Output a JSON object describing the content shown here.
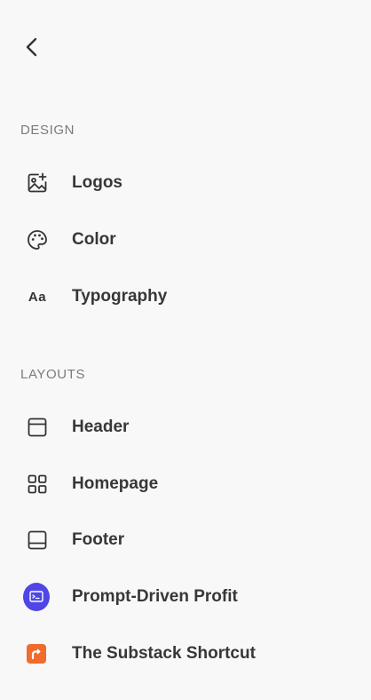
{
  "sections": {
    "design": {
      "title": "DESIGN",
      "items": [
        {
          "label": "Logos",
          "icon": "image-plus-icon"
        },
        {
          "label": "Color",
          "icon": "palette-icon"
        },
        {
          "label": "Typography",
          "icon": "typography-icon"
        }
      ]
    },
    "layouts": {
      "title": "LAYOUTS",
      "items": [
        {
          "label": "Header",
          "icon": "layout-header-icon"
        },
        {
          "label": "Homepage",
          "icon": "grid-icon"
        },
        {
          "label": "Footer",
          "icon": "layout-footer-icon"
        },
        {
          "label": "Prompt-Driven Profit",
          "icon": "publication-avatar-icon"
        },
        {
          "label": "The Substack Shortcut",
          "icon": "publication-avatar-icon"
        }
      ]
    }
  },
  "glyphs": {
    "typography_icon_text": "Aa"
  },
  "colors": {
    "background": "#f8f8f8",
    "text": "#363737",
    "section_title": "#7b7b7b",
    "purple_pub": "#4f46e5",
    "orange_pub": "#ef6c2c"
  }
}
